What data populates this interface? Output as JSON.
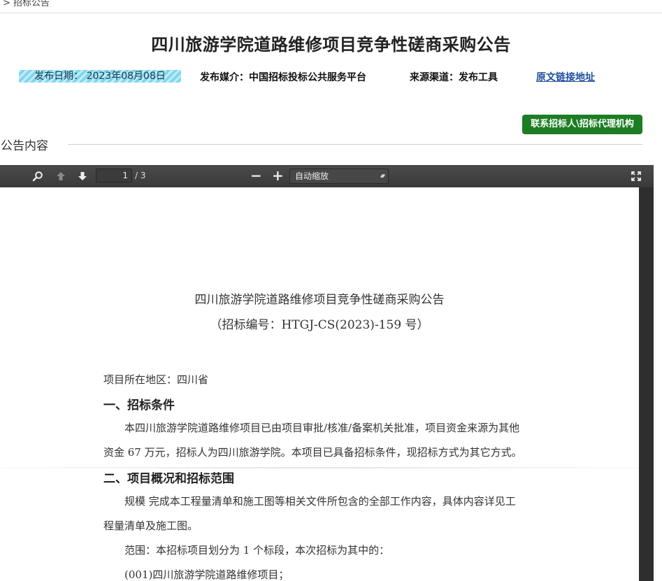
{
  "breadcrumb": "> 招标公告",
  "page_title": "四川旅游学院道路维修项目竞争性磋商采购公告",
  "meta": {
    "date": "发布日期：  2023年08月08日",
    "media": "发布媒介：中国招标投标公共服务平台",
    "source": "来源渠道：发布工具",
    "link": "原文链接地址"
  },
  "contact_button": "联系招标人\\招标代理机构",
  "section_label": "公告内容",
  "viewer": {
    "page_current": "1",
    "page_total": "/ 3",
    "zoom_out": "−",
    "zoom_in": "+",
    "zoom_value": "自动缩放",
    "icons": [
      "search-icon",
      "previous-page-icon",
      "next-page-icon",
      "presentation-mode-icon"
    ]
  },
  "document": {
    "title": "四川旅游学院道路维修项目竞争性磋商采购公告",
    "code": "（招标编号：HTGJ-CS(2023)-159 号）",
    "region": "项目所在地区：四川省",
    "h1": "一、招标条件",
    "p1a": "本四川旅游学院道路维修项目已由项目审批/核准/备案机关批准，项目资金来源为其他",
    "p1b": "资金 67 万元，招标人为四川旅游学院。本项目已具备招标条件，现招标方式为其它方式。",
    "h2": "二、项目概况和招标范围",
    "p2a": "规模 完成本工程量清单和施工图等相关文件所包含的全部工作内容，具体内容详见工",
    "p2b": "程量清单及施工图。",
    "p3": "范围：本招标项目划分为 1 个标段，本次招标为其中的：",
    "p4": "(001)四川旅游学院道路维修项目；"
  }
}
